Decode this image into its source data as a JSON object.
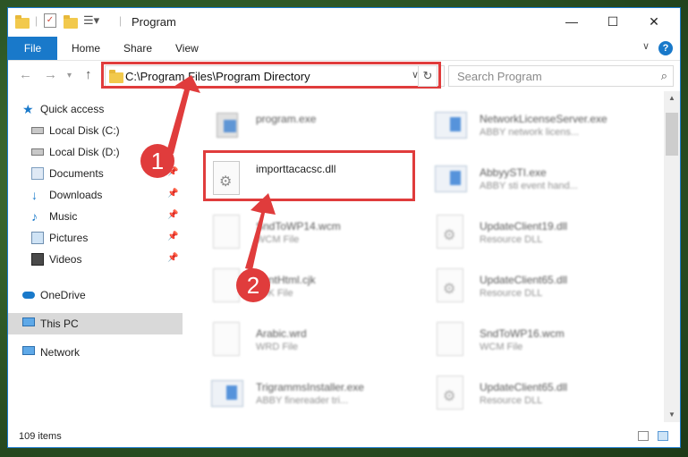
{
  "window": {
    "title": "Program",
    "controls": {
      "minimize": "—",
      "maximize": "☐",
      "close": "✕"
    }
  },
  "ribbon": {
    "tabs": [
      "File",
      "Home",
      "Share",
      "View"
    ],
    "help": "?"
  },
  "nav": {
    "address": "C:\\Program Files\\Program Directory",
    "search_placeholder": "Search Program"
  },
  "sidebar": {
    "items": [
      {
        "label": "Quick access",
        "icon": "star-icon"
      },
      {
        "label": "Local Disk (C:)",
        "icon": "drive-icon"
      },
      {
        "label": "Local Disk (D:)",
        "icon": "drive-icon"
      },
      {
        "label": "Documents",
        "icon": "documents-icon"
      },
      {
        "label": "Downloads",
        "icon": "download-icon"
      },
      {
        "label": "Music",
        "icon": "music-icon"
      },
      {
        "label": "Pictures",
        "icon": "pictures-icon"
      },
      {
        "label": "Videos",
        "icon": "videos-icon"
      },
      {
        "label": "OneDrive",
        "icon": "cloud-icon"
      },
      {
        "label": "This PC",
        "icon": "computer-icon"
      },
      {
        "label": "Network",
        "icon": "network-icon"
      }
    ]
  },
  "files": {
    "left": [
      {
        "name": "program.exe",
        "desc": ""
      },
      {
        "name": "importtacacsc.dll",
        "desc": ""
      },
      {
        "name": "SndToWP14.wcm",
        "desc": "WCM File"
      },
      {
        "name": "FontHtml.cjk",
        "desc": "CJK File"
      },
      {
        "name": "Arabic.wrd",
        "desc": "WRD File"
      },
      {
        "name": "TrigrammsInstaller.exe",
        "desc": "ABBY finereader tri..."
      }
    ],
    "right": [
      {
        "name": "NetworkLicenseServer.exe",
        "desc": "ABBY network licens..."
      },
      {
        "name": "AbbyySTI.exe",
        "desc": "ABBY sti event hand..."
      },
      {
        "name": "UpdateClient19.dll",
        "desc": "Resource DLL"
      },
      {
        "name": "UpdateClient65.dll",
        "desc": "Resource DLL"
      },
      {
        "name": "SndToWP16.wcm",
        "desc": "WCM File"
      },
      {
        "name": "UpdateClient65.dll",
        "desc": "Resource DLL"
      }
    ]
  },
  "status": {
    "item_count": "109 items"
  },
  "annotations": {
    "step1": "1",
    "step2": "2",
    "color": "#e03c3c"
  }
}
